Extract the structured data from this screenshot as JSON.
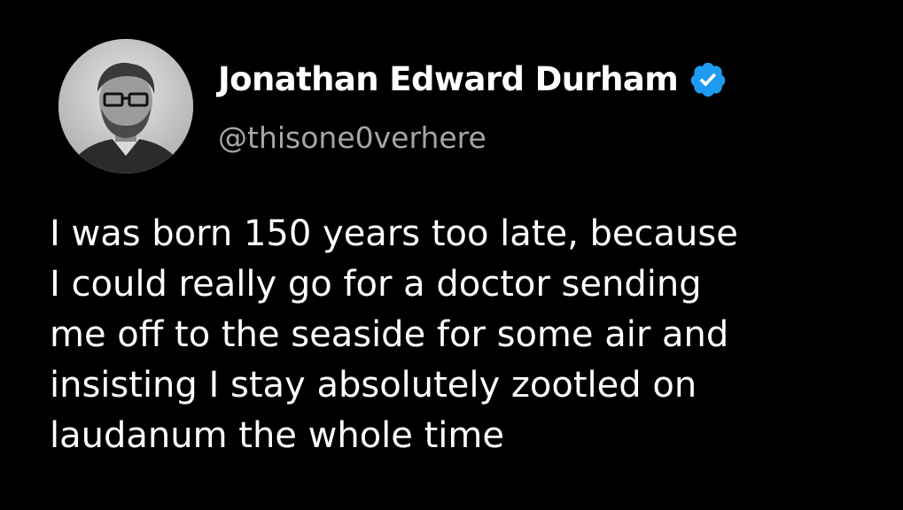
{
  "author": {
    "display_name": "Jonathan Edward Durham",
    "handle": "@thisone0verhere",
    "verified": true,
    "avatar_icon": "profile-photo-icon",
    "verified_icon": "verified-badge-icon"
  },
  "tweet": {
    "lines": [
      "I was born 150 years too late, because",
      "I could really go for a doctor sending",
      "me off to the seaside for some air and",
      "insisting I stay absolutely zootled on",
      "laudanum the whole time"
    ]
  },
  "colors": {
    "background": "#000000",
    "text": "#ffffff",
    "handle": "#a2a6aa",
    "verified": "#1d9bf0"
  }
}
